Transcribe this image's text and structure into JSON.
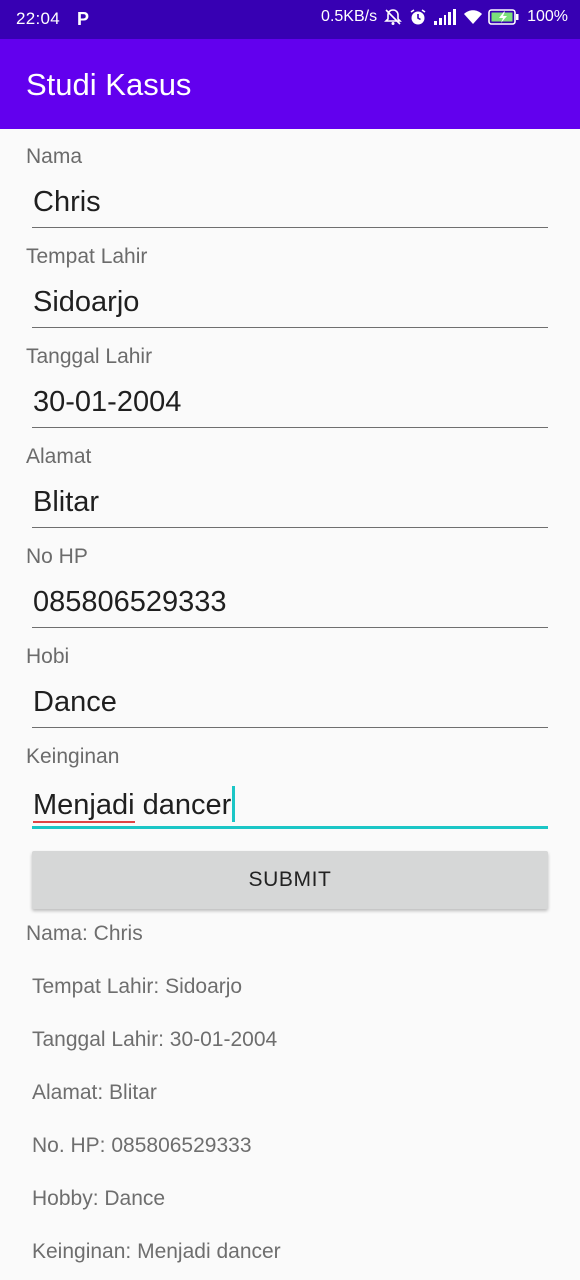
{
  "status_bar": {
    "time": "22:04",
    "app_icon": "P",
    "net_speed": "0.5KB/s",
    "battery": "100%",
    "icons": [
      "bell-off-icon",
      "alarm-icon",
      "signal-icon",
      "wifi-icon",
      "battery-charging-icon"
    ]
  },
  "app_bar": {
    "title": "Studi Kasus",
    "color": "#6200ee"
  },
  "form": {
    "fields": [
      {
        "label": "Nama",
        "value": "Chris"
      },
      {
        "label": "Tempat Lahir",
        "value": "Sidoarjo"
      },
      {
        "label": "Tanggal Lahir",
        "value": "30-01-2004"
      },
      {
        "label": "Alamat",
        "value": "Blitar"
      },
      {
        "label": "No HP",
        "value": "085806529333"
      },
      {
        "label": "Hobi",
        "value": "Dance"
      },
      {
        "label": "Keinginan",
        "value_part1": "Menjadi",
        "value_part2": " dancer"
      }
    ],
    "submit_label": "SUBMIT"
  },
  "result": [
    "Nama: Chris",
    "Tempat Lahir: Sidoarjo",
    "Tanggal Lahir: 30-01-2004",
    "Alamat: Blitar",
    "No. HP: 085806529333",
    "Hobby: Dance",
    "Keinginan: Menjadi dancer"
  ],
  "colors": {
    "accent": "#1bc6c6",
    "status_bar": "#3700b3"
  }
}
